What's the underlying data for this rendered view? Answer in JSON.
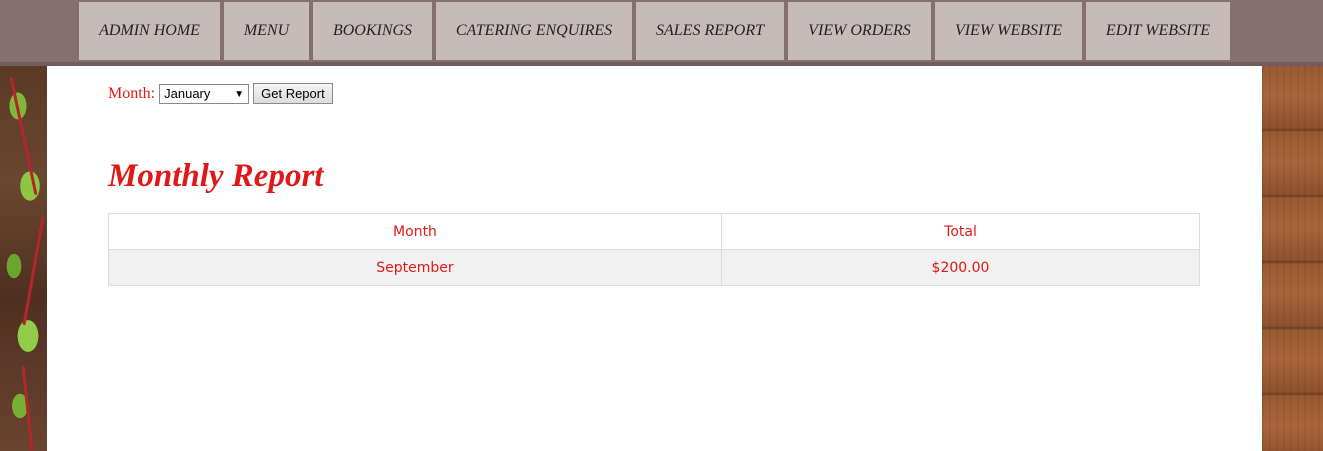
{
  "nav": {
    "items": [
      {
        "label": "ADMIN HOME"
      },
      {
        "label": "MENU"
      },
      {
        "label": "BOOKINGS"
      },
      {
        "label": "CATERING ENQUIRES"
      },
      {
        "label": "SALES REPORT"
      },
      {
        "label": "VIEW ORDERS"
      },
      {
        "label": "VIEW WEBSITE"
      },
      {
        "label": "EDIT WEBSITE"
      }
    ]
  },
  "form": {
    "month_label": "Month:",
    "month_selected": "January",
    "submit_label": "Get Report"
  },
  "report": {
    "heading": "Monthly Report",
    "columns": [
      "Month",
      "Total"
    ],
    "rows": [
      {
        "month": "September",
        "total": "$200.00"
      }
    ]
  },
  "colors": {
    "accent_red": "#e01818",
    "nav_bg": "#846f71",
    "nav_item_bg": "#c7bbba"
  }
}
